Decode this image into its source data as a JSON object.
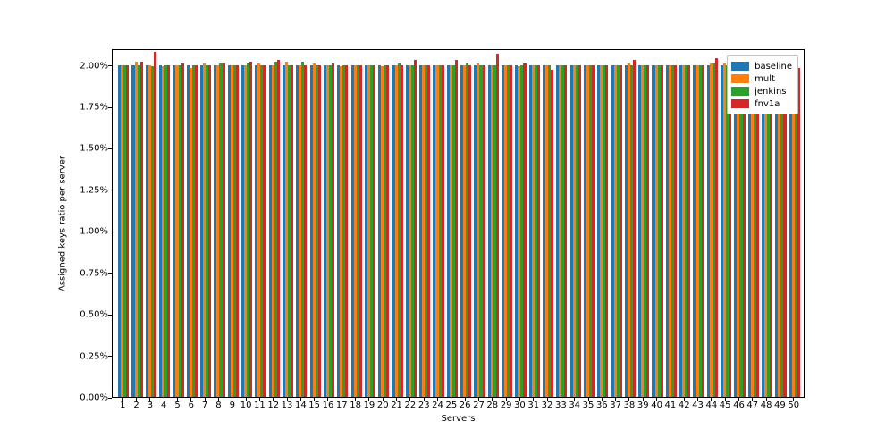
{
  "chart_data": {
    "type": "bar",
    "title": "",
    "xlabel": "Servers",
    "ylabel": "Assigned keys ratio per server",
    "categories": [
      "1",
      "2",
      "3",
      "4",
      "5",
      "6",
      "7",
      "8",
      "9",
      "10",
      "11",
      "12",
      "13",
      "14",
      "15",
      "16",
      "17",
      "18",
      "19",
      "20",
      "21",
      "22",
      "23",
      "24",
      "25",
      "26",
      "27",
      "28",
      "29",
      "30",
      "31",
      "32",
      "33",
      "34",
      "35",
      "36",
      "37",
      "38",
      "39",
      "40",
      "41",
      "42",
      "43",
      "44",
      "45",
      "46",
      "47",
      "48",
      "49",
      "50"
    ],
    "series": [
      {
        "name": "baseline",
        "color": "#1f77b4",
        "values": [
          2.0,
          2.0,
          2.0,
          2.0,
          2.0,
          2.0,
          2.0,
          2.0,
          2.0,
          2.0,
          2.0,
          2.0,
          2.0,
          2.0,
          2.0,
          2.0,
          2.0,
          2.0,
          2.0,
          2.0,
          2.0,
          2.0,
          2.0,
          2.0,
          2.0,
          2.0,
          2.0,
          2.0,
          2.0,
          2.0,
          2.0,
          2.0,
          2.0,
          2.0,
          2.0,
          2.0,
          2.0,
          2.0,
          2.0,
          2.0,
          2.0,
          2.0,
          2.0,
          2.0,
          2.0,
          2.0,
          2.0,
          2.0,
          2.0,
          2.0
        ]
      },
      {
        "name": "mult",
        "color": "#ff7f0e",
        "values": [
          2.0,
          2.02,
          2.0,
          1.99,
          2.0,
          1.98,
          2.01,
          2.0,
          2.0,
          2.0,
          2.01,
          2.0,
          2.02,
          2.0,
          2.01,
          2.0,
          1.99,
          2.0,
          2.0,
          1.99,
          2.0,
          2.0,
          2.0,
          2.0,
          2.0,
          2.0,
          2.01,
          2.0,
          2.0,
          1.99,
          2.0,
          2.0,
          2.0,
          2.0,
          2.0,
          2.0,
          2.0,
          2.01,
          2.0,
          2.0,
          2.0,
          2.0,
          2.0,
          2.01,
          2.01,
          2.0,
          2.0,
          2.0,
          2.0,
          1.99
        ]
      },
      {
        "name": "jenkins",
        "color": "#2ca02c",
        "values": [
          2.0,
          2.0,
          1.99,
          2.0,
          2.0,
          2.0,
          2.0,
          2.01,
          2.0,
          2.01,
          2.0,
          2.02,
          2.0,
          2.02,
          2.0,
          2.0,
          2.0,
          2.0,
          2.0,
          2.0,
          2.01,
          2.0,
          2.0,
          2.0,
          2.0,
          2.01,
          2.0,
          2.0,
          2.0,
          2.0,
          2.0,
          2.0,
          2.0,
          2.0,
          2.0,
          2.0,
          2.0,
          2.0,
          2.0,
          2.0,
          2.0,
          2.0,
          2.0,
          2.01,
          2.0,
          2.0,
          2.01,
          2.0,
          2.0,
          2.0
        ]
      },
      {
        "name": "fnv1a",
        "color": "#d62728",
        "values": [
          2.0,
          2.02,
          2.08,
          2.0,
          2.01,
          2.0,
          2.0,
          2.01,
          2.0,
          2.02,
          2.0,
          2.03,
          2.0,
          2.0,
          2.0,
          2.01,
          2.0,
          2.0,
          2.0,
          2.0,
          2.0,
          2.03,
          2.0,
          2.0,
          2.03,
          2.0,
          2.0,
          2.07,
          2.0,
          2.01,
          2.0,
          1.97,
          2.0,
          2.0,
          2.0,
          2.0,
          2.0,
          2.03,
          2.0,
          2.0,
          2.0,
          2.0,
          2.0,
          2.04,
          2.04,
          2.0,
          2.0,
          2.0,
          2.0,
          1.98
        ]
      }
    ],
    "ylim": [
      0.0,
      2.1
    ],
    "yticks": [
      0.0,
      0.25,
      0.5,
      0.75,
      1.0,
      1.25,
      1.5,
      1.75,
      2.0
    ],
    "ytick_labels": [
      "0.00%",
      "0.25%",
      "0.50%",
      "0.75%",
      "1.00%",
      "1.25%",
      "1.50%",
      "1.75%",
      "2.00%"
    ],
    "legend_position": "upper right"
  }
}
